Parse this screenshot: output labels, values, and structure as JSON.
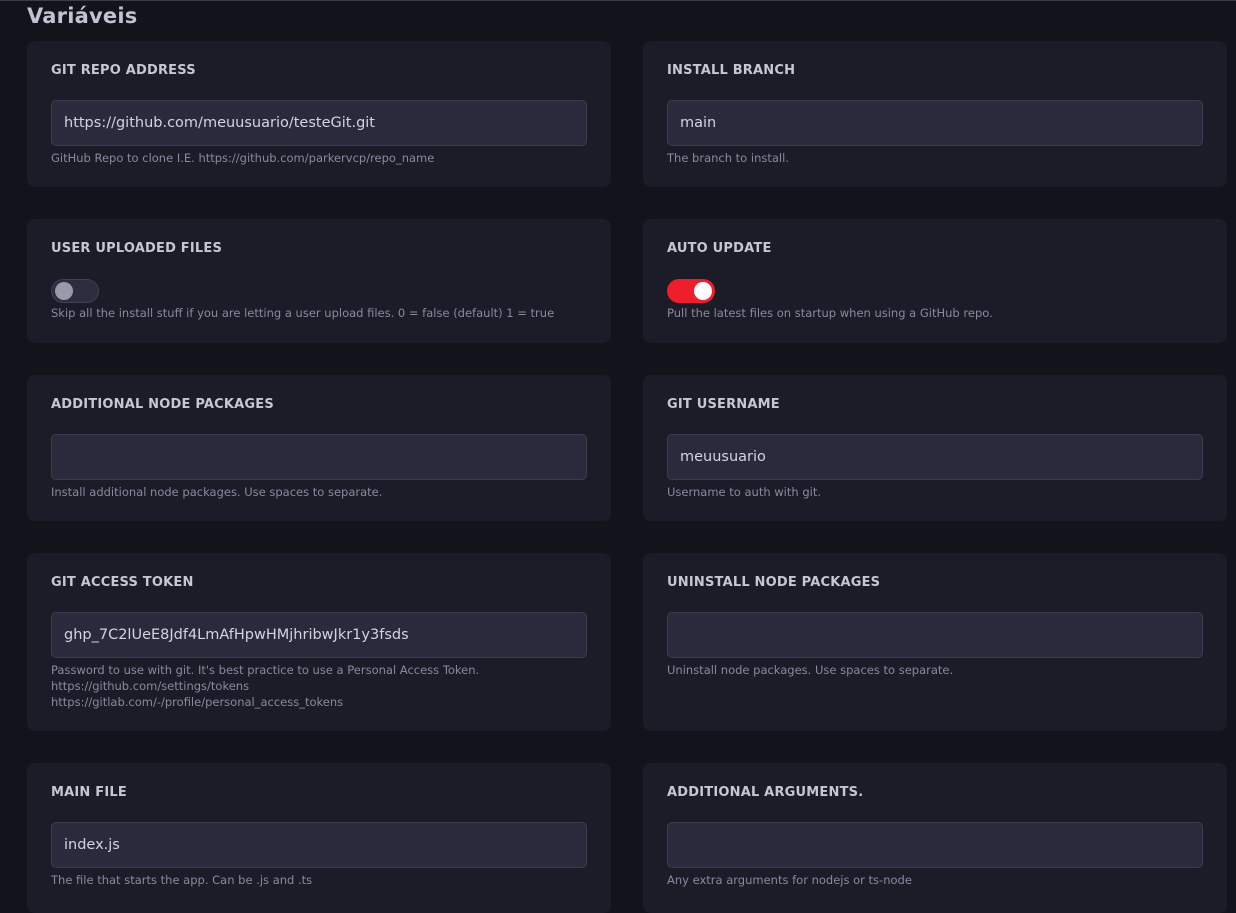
{
  "page": {
    "title": "Variáveis"
  },
  "variables": {
    "git_repo_address": {
      "label": "GIT REPO ADDRESS",
      "value": "https://github.com/meuusuario/testeGit.git",
      "description": "GitHub Repo to clone I.E. https://github.com/parkervcp/repo_name"
    },
    "install_branch": {
      "label": "INSTALL BRANCH",
      "value": "main",
      "description": "The branch to install."
    },
    "user_uploaded_files": {
      "label": "USER UPLOADED FILES",
      "enabled": false,
      "description": "Skip all the install stuff if you are letting a user upload files. 0 = false (default) 1 = true"
    },
    "auto_update": {
      "label": "AUTO UPDATE",
      "enabled": true,
      "description": "Pull the latest files on startup when using a GitHub repo."
    },
    "additional_node_packages": {
      "label": "ADDITIONAL NODE PACKAGES",
      "value": "",
      "description": "Install additional node packages. Use spaces to separate."
    },
    "git_username": {
      "label": "GIT USERNAME",
      "value": "meuusuario",
      "description": "Username to auth with git."
    },
    "git_access_token": {
      "label": "GIT ACCESS TOKEN",
      "value": "ghp_7C2lUeE8Jdf4LmAfHpwHMjhribwJkr1y3fsds",
      "description_lines": [
        "Password to use with git. It's best practice to use a Personal Access Token.",
        "https://github.com/settings/tokens",
        "https://gitlab.com/-/profile/personal_access_tokens"
      ]
    },
    "uninstall_node_packages": {
      "label": "UNINSTALL NODE PACKAGES",
      "value": "",
      "description": "Uninstall node packages. Use spaces to separate."
    },
    "main_file": {
      "label": "MAIN FILE",
      "value": "index.js",
      "description": "The file that starts the app. Can be .js and .ts"
    },
    "additional_arguments": {
      "label": "ADDITIONAL ARGUMENTS.",
      "value": "",
      "description": "Any extra arguments for nodejs or ts-node"
    }
  },
  "colors": {
    "background": "#13131c",
    "card": "#1c1b28",
    "input": "#2a2a3c",
    "toggle_on": "#ee1e2c",
    "toggle_off": "#2e2d40"
  }
}
